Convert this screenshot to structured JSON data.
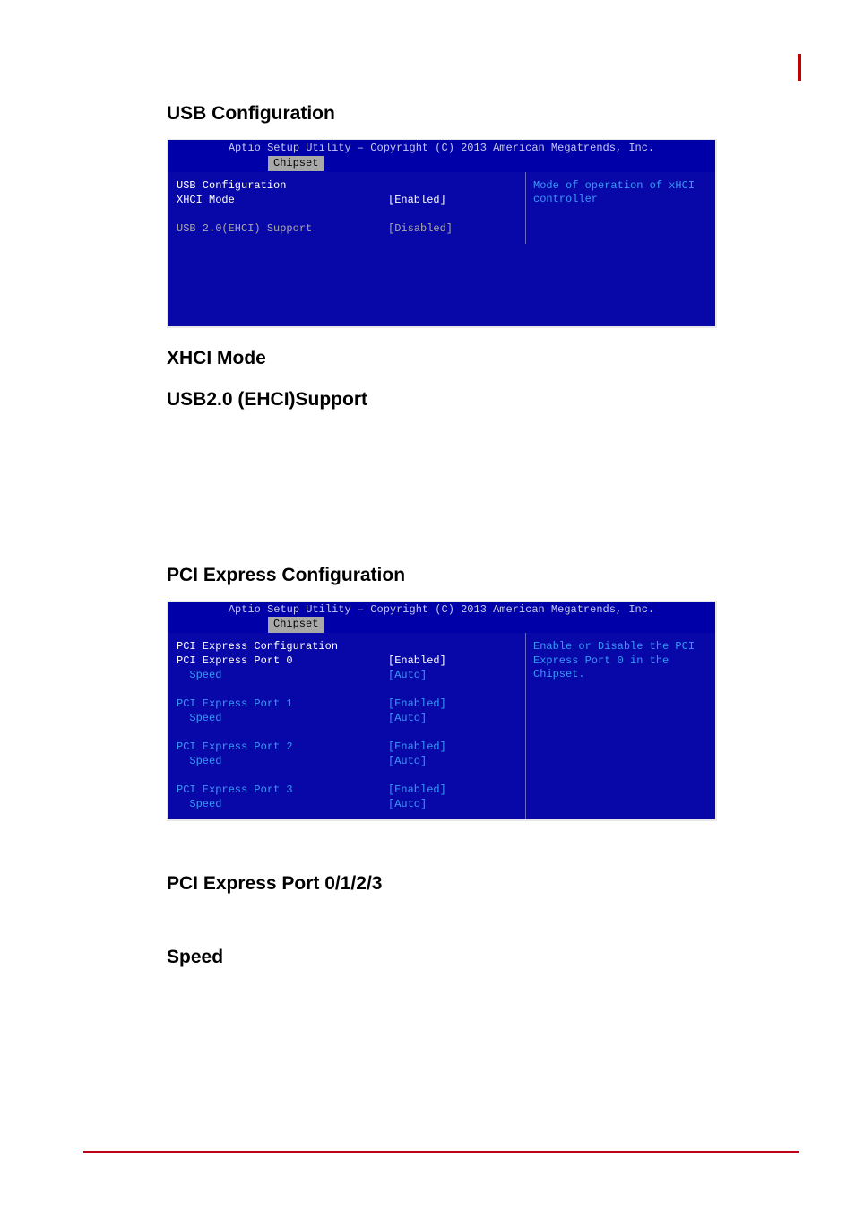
{
  "headings": {
    "usb_config": "USB Configuration",
    "xhci_mode": "XHCI Mode",
    "usb2_ehci": "USB2.0 (EHCI)Support",
    "pci_config": "PCI Express Configuration",
    "pci_ports": "PCI Express Port 0/1/2/3",
    "speed": "Speed"
  },
  "bios1": {
    "title": "Aptio Setup Utility – Copyright (C) 2013 American Megatrends, Inc.",
    "tab": "Chipset",
    "help": "Mode of operation of xHCI controller",
    "rows": [
      {
        "label": "USB Configuration",
        "value": "",
        "cls": "white"
      },
      {
        "label": "XHCI Mode",
        "value": "[Enabled]",
        "cls": "white"
      },
      {
        "label": "",
        "value": "",
        "cls": ""
      },
      {
        "label": "USB 2.0(EHCI) Support",
        "value": "[Disabled]",
        "cls": ""
      }
    ]
  },
  "bios2": {
    "title": "Aptio Setup Utility – Copyright (C) 2013 American Megatrends, Inc.",
    "tab": "Chipset",
    "help": "Enable or Disable the PCI Express Port 0 in the Chipset.",
    "rows": [
      {
        "label": "PCI Express Configuration",
        "value": "",
        "cls": "white"
      },
      {
        "label": "PCI Express Port 0",
        "value": "[Enabled]",
        "cls": "white"
      },
      {
        "label": "  Speed",
        "value": "[Auto]",
        "cls": "blue"
      },
      {
        "label": "",
        "value": "",
        "cls": ""
      },
      {
        "label": "PCI Express Port 1",
        "value": "[Enabled]",
        "cls": "blue"
      },
      {
        "label": "  Speed",
        "value": "[Auto]",
        "cls": "blue"
      },
      {
        "label": "",
        "value": "",
        "cls": ""
      },
      {
        "label": "PCI Express Port 2",
        "value": "[Enabled]",
        "cls": "blue"
      },
      {
        "label": "  Speed",
        "value": "[Auto]",
        "cls": "blue"
      },
      {
        "label": "",
        "value": "",
        "cls": ""
      },
      {
        "label": "PCI Express Port 3",
        "value": "[Enabled]",
        "cls": "blue"
      },
      {
        "label": "  Speed",
        "value": "[Auto]",
        "cls": "blue"
      }
    ]
  }
}
